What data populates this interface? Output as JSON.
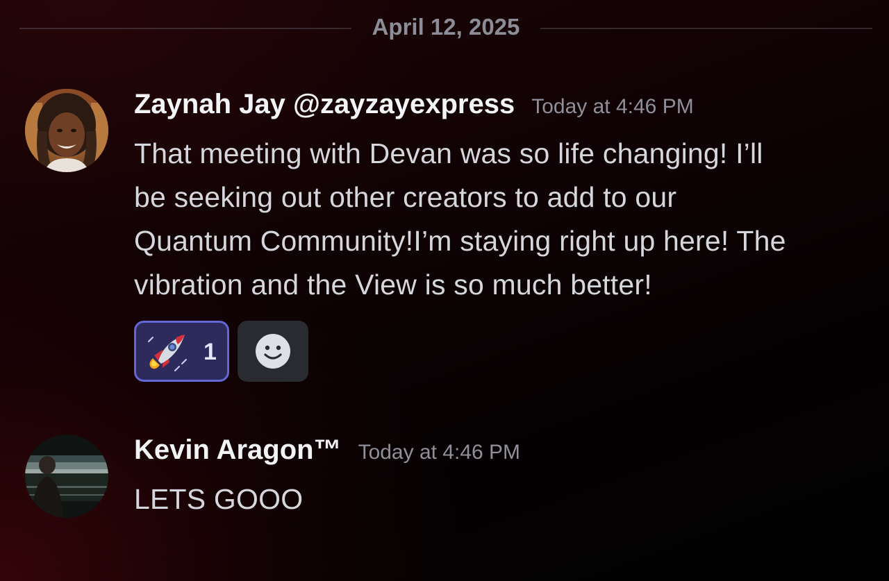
{
  "date_divider": "April 12, 2025",
  "messages": [
    {
      "author": "Zaynah Jay @zayzayexpress",
      "timestamp": "Today at 4:46 PM",
      "lines": [
        "That meeting with Devan was so life changing!  I’ll",
        "be seeking out other creators to add to our",
        "Quantum Community!I’m staying right up here!  The",
        "vibration and the View is so much better!"
      ],
      "reactions": [
        {
          "icon": "rocket-emoji",
          "count": "1"
        }
      ],
      "add_reaction_icon": "smiley-face-icon"
    },
    {
      "author": "Kevin Aragon™",
      "timestamp": "Today at 4:46 PM",
      "lines": [
        "LETS GOOO"
      ]
    }
  ],
  "colors": {
    "reaction_active_bg": "#2d2a5c",
    "reaction_active_border": "#6467d6",
    "add_reaction_bg": "#2a2b31",
    "timestamp": "#8f909a"
  }
}
